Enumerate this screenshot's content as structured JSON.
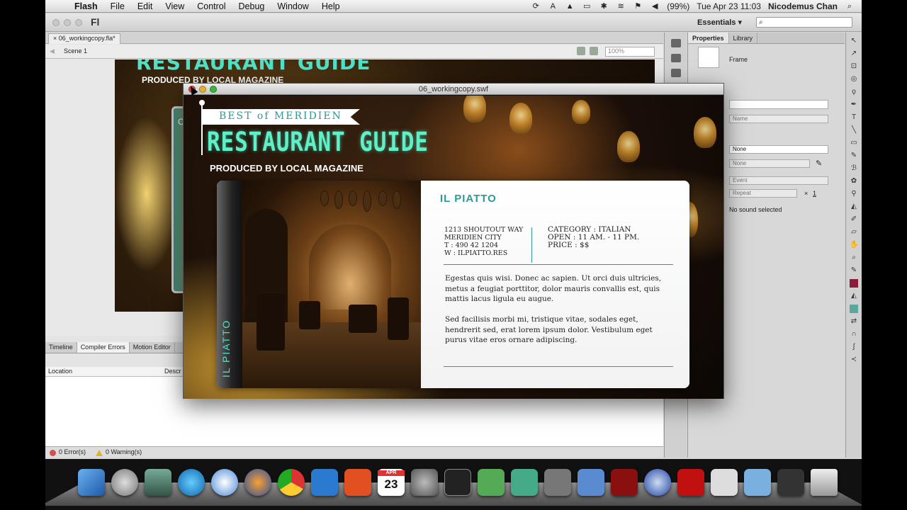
{
  "menubar": {
    "app": "Flash",
    "items": [
      "File",
      "Edit",
      "View",
      "Control",
      "Debug",
      "Window",
      "Help"
    ],
    "battery": "(99%)",
    "datetime": "Tue Apr 23  11:03",
    "user": "Nicodemus Chan"
  },
  "app": {
    "logo": "Fl",
    "workspace": "Essentials",
    "search_placeholder": ""
  },
  "document": {
    "tab": "06_workingcopy.fla*",
    "scene": "Scene 1",
    "zoom": "100%",
    "stage_title": "RESTAURANT GUIDE",
    "stage_sub": "PRODUCED BY LOCAL MAGAZINE",
    "stage_card_letter": "C"
  },
  "bottom_panel": {
    "tabs": [
      "Timeline",
      "Compiler Errors",
      "Motion Editor"
    ],
    "col_location": "Location",
    "col_desc": "Descr",
    "errors": "0 Error(s)",
    "warnings": "0 Warning(s)"
  },
  "properties": {
    "tabs": [
      "Properties",
      "Library"
    ],
    "type": "Frame",
    "name_placeholder": "Name",
    "tween": "None",
    "effect": "None",
    "sync": "Event",
    "repeat": "Repeat",
    "repeat_count": "1",
    "sound_status": "No sound selected"
  },
  "swf": {
    "window_title": "06_workingcopy.swf",
    "banner": "BEST of MERIDIEN",
    "title": "RESTAURANT GUIDE",
    "produced": "PRODUCED BY LOCAL MAGAZINE",
    "card": {
      "spine_label": "IL PIATTO",
      "name": "IL PIATTO",
      "address": [
        "1213 SHOUTOUT WAY",
        "MERIDIEN CITY",
        "T : 490 42 1204",
        "W : ILPIATTO.RES"
      ],
      "details": [
        "CATEGORY : ITALIAN",
        "OPEN  : 11 AM. - 11 PM.",
        "PRICE   : $$"
      ],
      "para1": "Egestas quis wisi. Donec ac sapien. Ut orci duis ultricies, metus a feugiat porttitor, dolor mauris convallis est, quis mattis lacus ligula eu augue.",
      "para2": "Sed facilisis morbi mi, tristique vitae, sodales eget, hendrerit sed, erat lorem ipsum dolor. Vestibulum eget purus vitae eros ornare adipiscing."
    }
  },
  "dock": {
    "calendar_month": "APR",
    "calendar_day": "23"
  }
}
